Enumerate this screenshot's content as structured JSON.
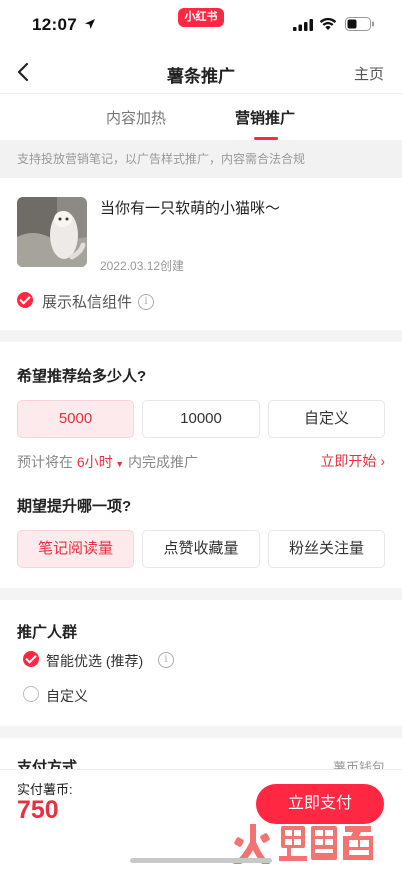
{
  "status_bar": {
    "time": "12:07",
    "app_badge": "小红书"
  },
  "nav": {
    "title": "薯条推广",
    "home": "主页"
  },
  "tabs": [
    {
      "label": "内容加热",
      "active": false
    },
    {
      "label": "营销推广",
      "active": true
    }
  ],
  "notice": "支持投放营销笔记，以广告样式推广，内容需合法合规",
  "note": {
    "title": "当你有一只软萌的小猫咪～",
    "date": "2022.03.12创建",
    "dm_component_label": "展示私信组件",
    "dm_component_checked": true
  },
  "audience_size": {
    "title": "希望推荐给多少人?",
    "options": [
      "5000",
      "10000",
      "自定义"
    ],
    "selected": "5000",
    "estimate_prefix": "预计将在",
    "estimate_value": "6小时",
    "estimate_suffix": "内完成推广",
    "start_link": "立即开始"
  },
  "goal": {
    "title": "期望提升哪一项?",
    "options": [
      "笔记阅读量",
      "点赞收藏量",
      "粉丝关注量"
    ],
    "selected": "笔记阅读量"
  },
  "target": {
    "title": "推广人群",
    "options": [
      {
        "label": "智能优选 (推荐)",
        "checked": true
      },
      {
        "label": "自定义",
        "checked": false
      }
    ]
  },
  "payment_method": {
    "label": "支付方式",
    "value": "薯币钱包"
  },
  "bottom": {
    "pay_label": "实付薯币:",
    "amount": "750",
    "button": "立即支付"
  },
  "colors": {
    "accent": "#ff2741",
    "accent_text": "#e8303f",
    "selected_bg": "#fdeaec"
  }
}
